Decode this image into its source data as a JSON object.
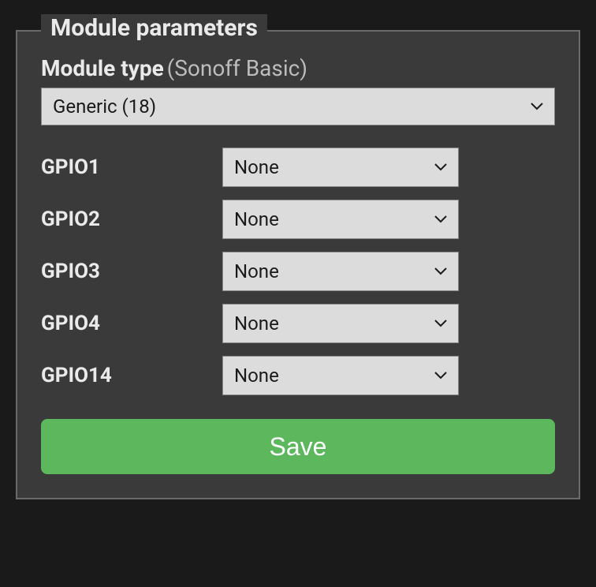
{
  "fieldset": {
    "legend": "Module parameters"
  },
  "module_type": {
    "label": "Module type",
    "hint": "(Sonoff Basic)",
    "selected": "Generic (18)"
  },
  "gpio": [
    {
      "label": "GPIO1",
      "value": "None"
    },
    {
      "label": "GPIO2",
      "value": "None"
    },
    {
      "label": "GPIO3",
      "value": "None"
    },
    {
      "label": "GPIO4",
      "value": "None"
    },
    {
      "label": "GPIO14",
      "value": "None"
    }
  ],
  "buttons": {
    "save": "Save"
  }
}
